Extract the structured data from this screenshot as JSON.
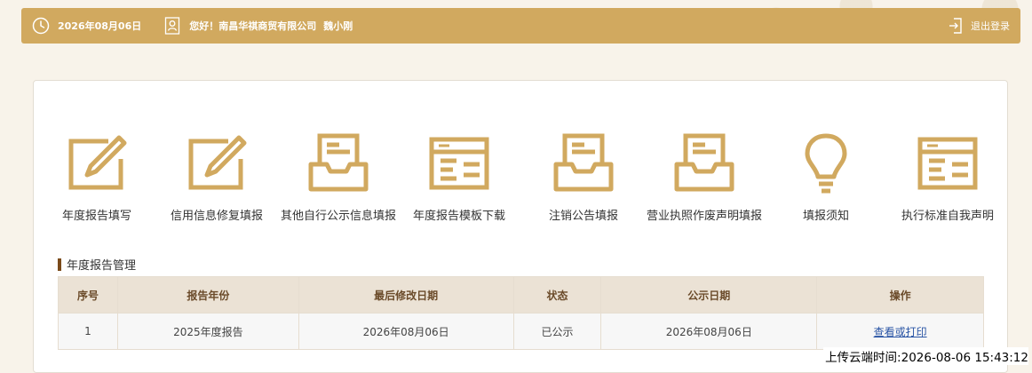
{
  "header": {
    "date": "2026年08月06日",
    "greeting": "您好！南昌华祺商贸有限公司",
    "user_name": "魏小刚",
    "logout_label": "退出登录",
    "icons": {
      "clock": "clock-icon",
      "user": "user-card-icon",
      "logout": "logout-icon"
    }
  },
  "nav_items": [
    {
      "label": "年度报告填写",
      "icon": "edit-icon"
    },
    {
      "label": "信用信息修复填报",
      "icon": "edit-icon"
    },
    {
      "label": "其他自行公示信息填报",
      "icon": "inbox-icon"
    },
    {
      "label": "年度报告模板下载",
      "icon": "window-icon"
    },
    {
      "label": "注销公告填报",
      "icon": "inbox-icon"
    },
    {
      "label": "营业执照作废声明填报",
      "icon": "inbox-icon"
    },
    {
      "label": "填报须知",
      "icon": "lightbulb-icon"
    },
    {
      "label": "执行标准自我声明",
      "icon": "window-icon"
    }
  ],
  "section_title": "年度报告管理",
  "table": {
    "headers": [
      "序号",
      "报告年份",
      "最后修改日期",
      "状态",
      "公示日期",
      "操作"
    ],
    "rows": [
      [
        "1",
        "2025年度报告",
        "2026年08月06日",
        "已公示",
        "2026年08月06日",
        "查看或打印"
      ]
    ]
  },
  "upload_time": "上传云端时间:2026-08-06 15:43:12",
  "colors": {
    "accent": "#d1a95f",
    "icon": "#d1a95f",
    "section_bar": "#7a4a1a",
    "table_header_bg": "#ebe2d5",
    "link": "#2a55a5"
  }
}
